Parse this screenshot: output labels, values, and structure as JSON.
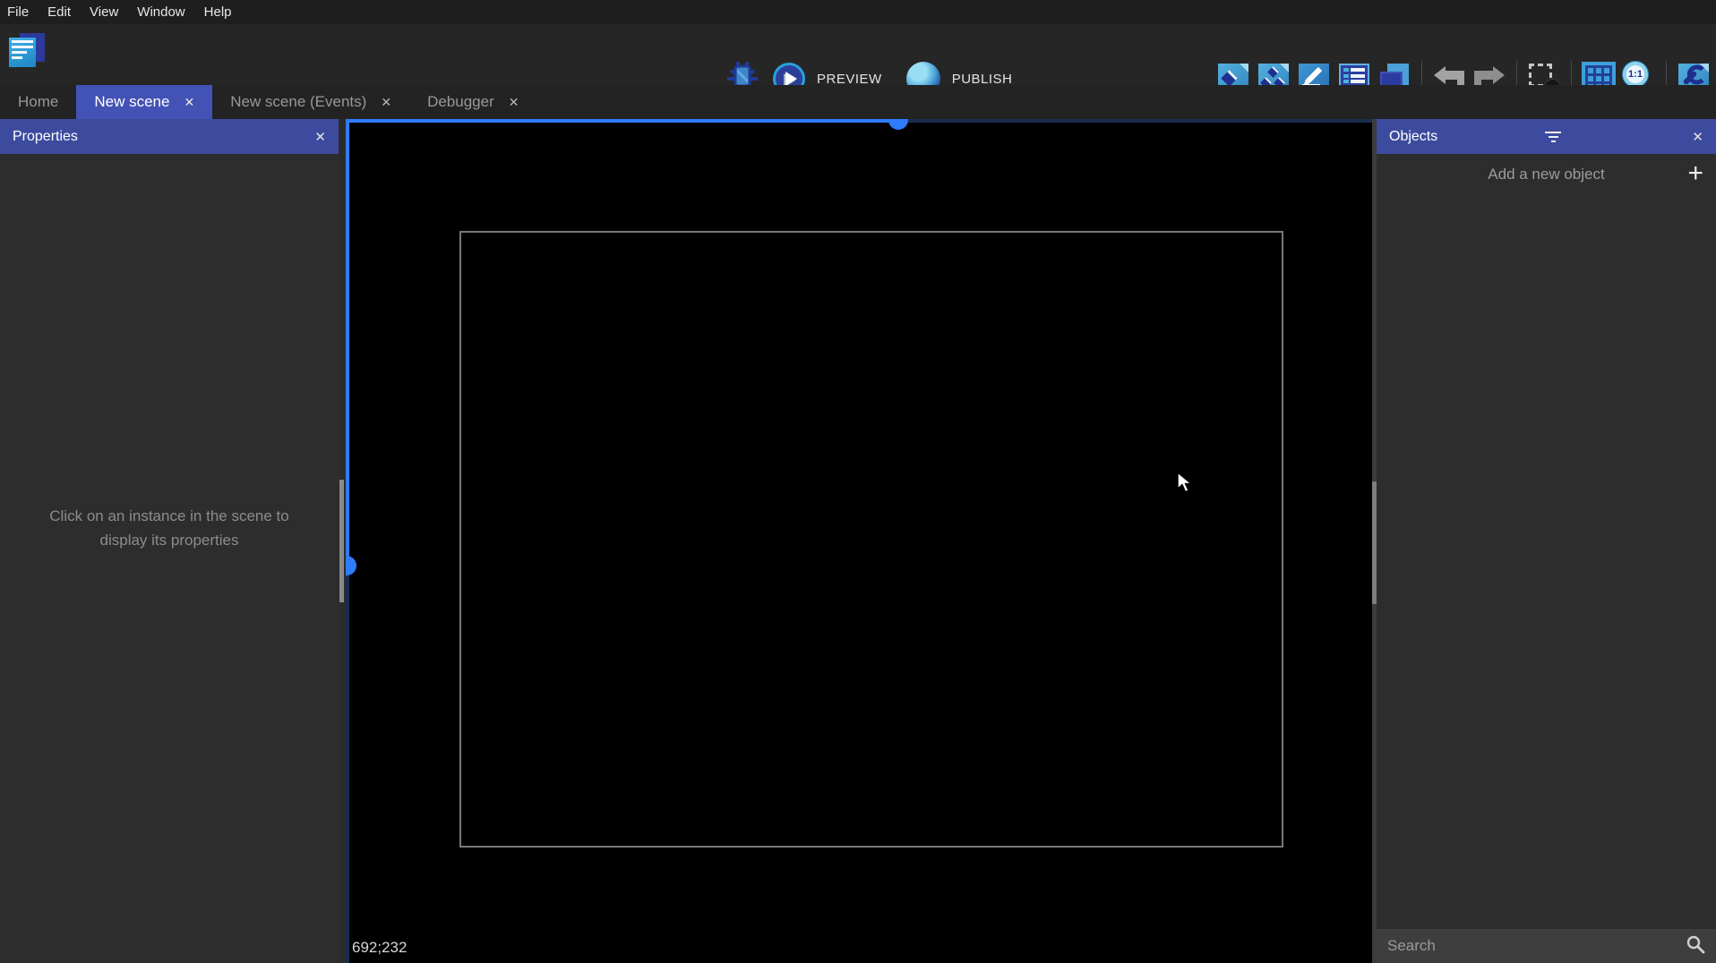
{
  "window": {
    "menu_items": [
      "File",
      "Edit",
      "View",
      "Window",
      "Help"
    ]
  },
  "toolbar": {
    "preview_label": "PREVIEW",
    "publish_label": "PUBLISH",
    "icon_names": [
      "project-manager",
      "debugger-bug",
      "preview-play",
      "publish-sphere",
      "objects-editor",
      "object-groups-editor",
      "properties-pencil",
      "instances-list",
      "layers-editor",
      "undo",
      "redo",
      "deselect-instances",
      "toggle-grid",
      "zoom-1-1",
      "scene-settings-wrench"
    ]
  },
  "tabs": [
    {
      "label": "Home",
      "active": false,
      "closable": false
    },
    {
      "label": "New scene",
      "active": true,
      "closable": true
    },
    {
      "label": "New scene (Events)",
      "active": false,
      "closable": true
    },
    {
      "label": "Debugger",
      "active": false,
      "closable": true
    }
  ],
  "properties_panel": {
    "title": "Properties",
    "hint": "Click on an instance in the scene to display its properties"
  },
  "objects_panel": {
    "title": "Objects",
    "add_button_label": "Add a new object",
    "search_placeholder": "Search"
  },
  "scene_canvas": {
    "cursor_coordinates": "692;232"
  },
  "icons": {
    "close": "✕",
    "plus": "+"
  },
  "colors": {
    "accent_blue": "#2e7bfe",
    "scrollbar_dark": "#1b2c4e",
    "header_indigo": "#3d4b9e",
    "active_tab": "#4352b5",
    "canvas_bg": "#000000",
    "scene_frame_border": "#787878"
  }
}
